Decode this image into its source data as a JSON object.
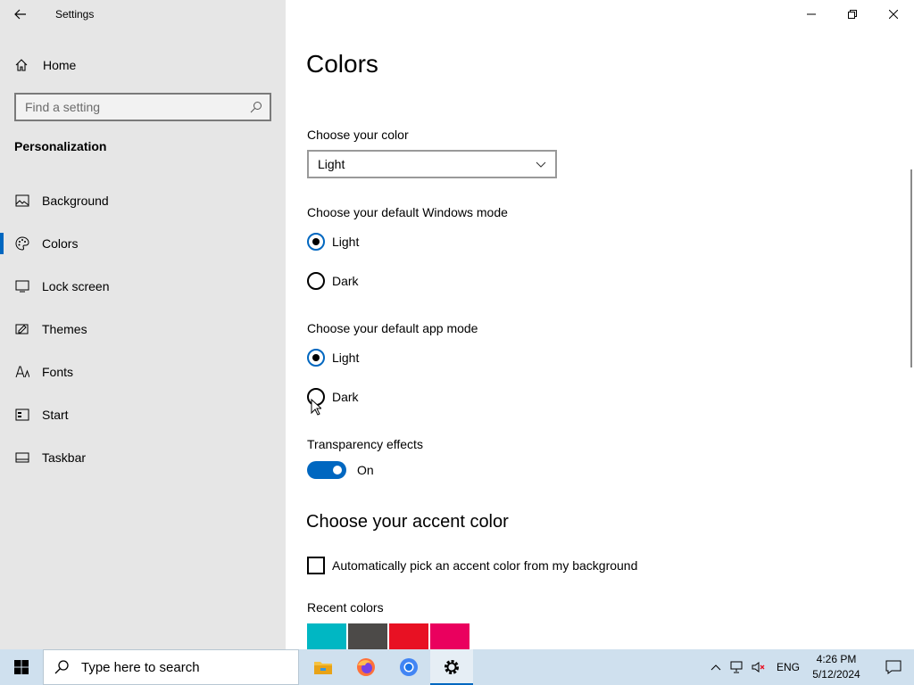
{
  "window": {
    "title": "Settings"
  },
  "sidebar": {
    "home_label": "Home",
    "search_placeholder": "Find a setting",
    "section_title": "Personalization",
    "items": [
      {
        "label": "Background",
        "icon": "picture-icon"
      },
      {
        "label": "Colors",
        "icon": "palette-icon",
        "active": true
      },
      {
        "label": "Lock screen",
        "icon": "lock-screen-icon"
      },
      {
        "label": "Themes",
        "icon": "themes-icon"
      },
      {
        "label": "Fonts",
        "icon": "fonts-icon"
      },
      {
        "label": "Start",
        "icon": "start-icon"
      },
      {
        "label": "Taskbar",
        "icon": "taskbar-icon"
      }
    ]
  },
  "main": {
    "title": "Colors",
    "choose_color_label": "Choose your color",
    "choose_color_value": "Light",
    "windows_mode_label": "Choose your default Windows mode",
    "windows_mode_options": [
      "Light",
      "Dark"
    ],
    "windows_mode_selected": "Light",
    "app_mode_label": "Choose your default app mode",
    "app_mode_options": [
      "Light",
      "Dark"
    ],
    "app_mode_selected": "Light",
    "transparency_label": "Transparency effects",
    "transparency_state": "On",
    "accent_heading": "Choose your accent color",
    "auto_accent_label": "Automatically pick an accent color from my background",
    "recent_colors_label": "Recent colors",
    "recent_colors": [
      "#00b7c3",
      "#4c4a48",
      "#e81123",
      "#ea005e"
    ]
  },
  "taskbar": {
    "search_placeholder": "Type here to search",
    "apps": [
      "file-explorer-icon",
      "firefox-icon",
      "chrome-icon",
      "settings-gear-icon"
    ],
    "language": "ENG",
    "time": "4:26 PM",
    "date": "5/12/2024"
  },
  "colors": {
    "accent": "#0067c0",
    "sidebar_bg": "#e6e6e6",
    "taskbar_bg": "#cfe0ee"
  }
}
